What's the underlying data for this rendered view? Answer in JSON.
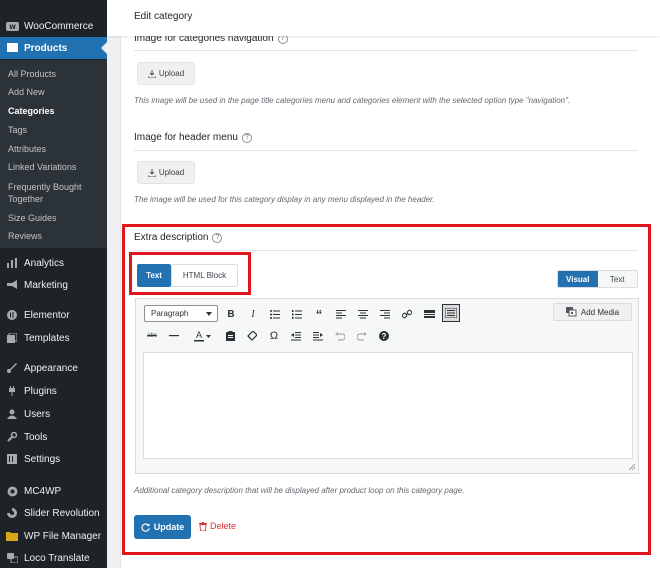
{
  "sidebar": {
    "top_items": [
      {
        "label": "WooCommerce",
        "icon": "woo-icon"
      },
      {
        "label": "Products",
        "icon": "products-icon",
        "active": true
      }
    ],
    "submenu": [
      {
        "label": "All Products"
      },
      {
        "label": "Add New"
      },
      {
        "label": "Categories",
        "current": true
      },
      {
        "label": "Tags"
      },
      {
        "label": "Attributes"
      },
      {
        "label": "Linked Variations"
      },
      {
        "label": "Frequently Bought Together"
      },
      {
        "label": "Size Guides"
      },
      {
        "label": "Reviews"
      }
    ],
    "bottom_items": [
      {
        "label": "Analytics",
        "icon": "analytics-icon"
      },
      {
        "label": "Marketing",
        "icon": "marketing-icon"
      },
      {
        "label": "Elementor",
        "icon": "elementor-icon"
      },
      {
        "label": "Templates",
        "icon": "templates-icon"
      },
      {
        "label": "Appearance",
        "icon": "appearance-icon"
      },
      {
        "label": "Plugins",
        "icon": "plugins-icon"
      },
      {
        "label": "Users",
        "icon": "users-icon"
      },
      {
        "label": "Tools",
        "icon": "tools-icon"
      },
      {
        "label": "Settings",
        "icon": "settings-icon"
      },
      {
        "label": "MC4WP",
        "icon": "mc4wp-icon"
      },
      {
        "label": "Slider Revolution",
        "icon": "slider-icon"
      },
      {
        "label": "WP File Manager",
        "icon": "folder-icon"
      },
      {
        "label": "Loco Translate",
        "icon": "translate-icon"
      }
    ]
  },
  "header": {
    "title": "Edit category"
  },
  "fields": {
    "nav_image": {
      "label": "Image for categories navigation",
      "upload_label": "Upload",
      "description": "This image will be used in the page title categories menu and categories element with the selected option type \"navigation\"."
    },
    "header_image": {
      "label": "Image for header menu",
      "upload_label": "Upload",
      "description": "The image will be used for this category display in any menu displayed in the header."
    },
    "extra_description": {
      "label": "Extra description",
      "tabs": [
        "Text",
        "HTML Block"
      ],
      "active_tab": "Text",
      "editor_modes": [
        "Visual",
        "Text"
      ],
      "active_mode": "Visual",
      "format_select": "Paragraph",
      "add_media_label": "Add Media",
      "description": "Additional category description that will be displayed after product loop on this category page."
    }
  },
  "actions": {
    "update_label": "Update",
    "delete_label": "Delete"
  },
  "colors": {
    "accent": "#2271b1",
    "highlight": "#e0161f",
    "sidebar_bg": "#1d2327",
    "delete": "#d63638"
  }
}
